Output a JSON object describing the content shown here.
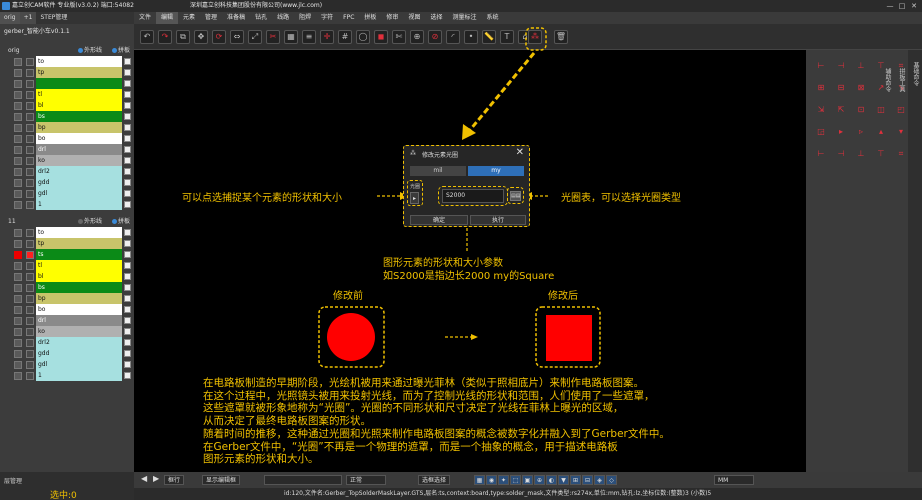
{
  "window": {
    "title": "嘉立创CAM软件 专业版(v3.0.2) 端口:54082",
    "company": "深圳嘉立创科技集团股份有限公司(www.jlc.com)",
    "controls": [
      "—",
      "□",
      "✕"
    ]
  },
  "left_panel": {
    "tabs": [
      "orig",
      "+1",
      "STEP管理"
    ],
    "project": "gerber_智能小车v0.1.1",
    "groups": [
      {
        "name": "orig",
        "outline": "外形线",
        "panel": "拼板"
      },
      {
        "name": "11",
        "outline": "外形线",
        "panel": "拼板"
      }
    ],
    "layers_group1": [
      {
        "name": "to",
        "color": "#ffffff"
      },
      {
        "name": "tp",
        "color": "#c8c46a"
      },
      {
        "name": "",
        "color": "#0b8a17"
      },
      {
        "name": "tl",
        "color": "#ffff00"
      },
      {
        "name": "bl",
        "color": "#ffff00"
      },
      {
        "name": "bs",
        "color": "#0b8a17"
      },
      {
        "name": "bp",
        "color": "#c8c46a"
      },
      {
        "name": "bo",
        "color": "#ffffff"
      },
      {
        "name": "drl",
        "color": "#8a8a8a"
      },
      {
        "name": "ko",
        "color": "#b0b0b0"
      },
      {
        "name": "drl2",
        "color": "#a6e0e0"
      },
      {
        "name": "gdd",
        "color": "#a6e0e0"
      },
      {
        "name": "gdl",
        "color": "#a6e0e0"
      },
      {
        "name": "1",
        "color": "#a6e0e0"
      }
    ],
    "layers_group2": [
      {
        "name": "to",
        "color": "#ffffff"
      },
      {
        "name": "tp",
        "color": "#c8c46a"
      },
      {
        "name": "ts",
        "color": "#0b8a17"
      },
      {
        "name": "tl",
        "color": "#ffff00"
      },
      {
        "name": "bl",
        "color": "#ffff00"
      },
      {
        "name": "bs",
        "color": "#0b8a17"
      },
      {
        "name": "bp",
        "color": "#c8c46a"
      },
      {
        "name": "bo",
        "color": "#ffffff"
      },
      {
        "name": "drl",
        "color": "#8a8a8a"
      },
      {
        "name": "ko",
        "color": "#b0b0b0"
      },
      {
        "name": "drl2",
        "color": "#a6e0e0"
      },
      {
        "name": "gdd",
        "color": "#a6e0e0"
      },
      {
        "name": "gdl",
        "color": "#a6e0e0"
      },
      {
        "name": "1",
        "color": "#a6e0e0"
      }
    ],
    "layer_manager": "层管理",
    "selected": "选中:0"
  },
  "menu": [
    "文件",
    "编辑",
    "元素",
    "管理",
    "准备稿",
    "钻孔",
    "线路",
    "阻焊",
    "字符",
    "FPC",
    "拼板",
    "修审",
    "视图",
    "选择",
    "测量标注",
    "系统"
  ],
  "toolbar_icons": [
    "undo-icon",
    "redo-icon",
    "copy-icon",
    "move-icon",
    "rotate-icon",
    "mirror-icon",
    "scale-icon",
    "delete-icon",
    "array-icon",
    "align-icon",
    "snap-icon",
    "grid-icon",
    "contour-icon",
    "fill-icon",
    "cut-icon",
    "join-icon",
    "break-icon",
    "arc-icon",
    "node-icon",
    "measure-icon",
    "text-icon",
    "feature-icon",
    "change-symbol-icon",
    "trash-icon"
  ],
  "dialog": {
    "title": "修改元素光圈",
    "unit_mil": "mil",
    "unit_my": "my",
    "shape_label": "光圈",
    "size_value": "S2000",
    "aperture_btn": "▤▤",
    "ok": "确定",
    "run": "执行"
  },
  "annotations": {
    "left": "可以点选捕捉某个元素的形状和大小",
    "right": "光圈表，可以选择光圈类型",
    "mid_line1": "图形元素的形状和大小参数",
    "mid_line2": "如S2000是指边长2000 my的Square",
    "before": "修改前",
    "after": "修改后",
    "paragraph": [
      "在电路板制造的早期阶段，光绘机被用来通过曝光菲林（类似于照相底片）来制作电路板图案。",
      "在这个过程中，光照镜头被用来投射光线，而为了控制光线的形状和范围，人们使用了一些遮罩，",
      "这些遮罩就被形象地称为“光圈”。光圈的不同形状和尺寸决定了光线在菲林上曝光的区域，",
      "从而决定了最终电路板图案的形状。",
      "随着时间的推移，这种通过光圈和光照来制作电路板图案的概念被数字化并融入到了Gerber文件中。",
      "在Gerber文件中，“光圈”不再是一个物理的遮罩，而是一个抽象的概念，用于描述电路板",
      "图形元素的形状和大小。"
    ],
    "colors": {
      "accent": "#f0c000",
      "shape": "#ff0000"
    }
  },
  "right_panel": {
    "sidebar_tabs": [
      "基础命令",
      "拼板工具",
      "辅助命令"
    ]
  },
  "bottom": {
    "mode": "框行",
    "display_btn": "显示编辑框",
    "shape_select": "正常",
    "select_btn": "选框选择",
    "unit": "MM"
  },
  "status": "id:120,文件名:Gerber_TopSolderMaskLayer.GTS,层名:ts,context:board,type:solder_mask,文件类型:rs274x,单位:mm,钻孔:lz,坐标位数:(整数)3 (小数)5"
}
